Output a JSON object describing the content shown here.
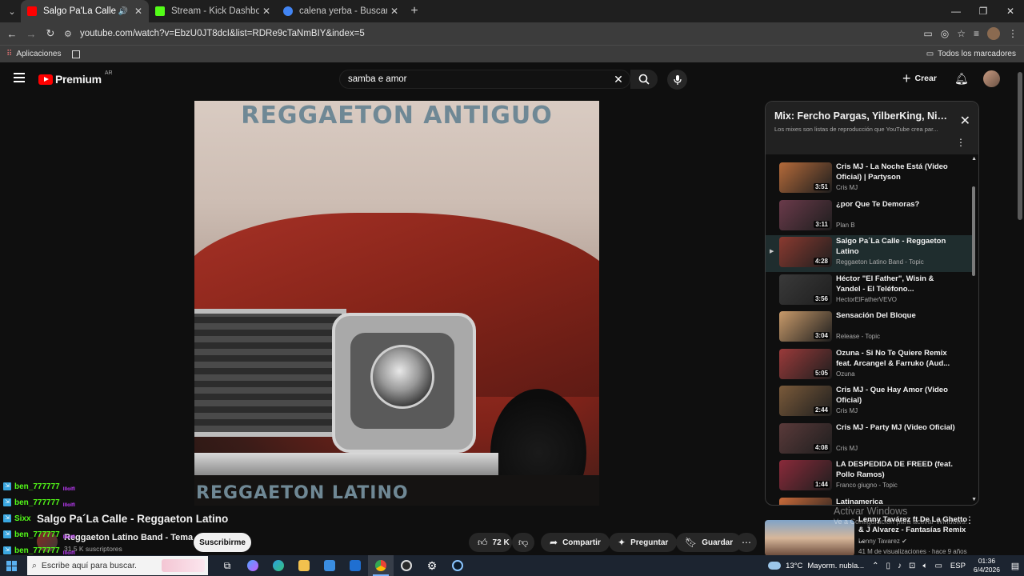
{
  "browser": {
    "tabs": [
      {
        "title": "Salgo Pa'La Calle - Reggae",
        "favicon_color": "#ff0000",
        "active": true,
        "audio": true
      },
      {
        "title": "Stream - Kick Dashboard",
        "favicon_color": "#53fc18",
        "active": false
      },
      {
        "title": "calena yerba - Buscar con Goog",
        "favicon_color": "#4285f4",
        "active": false
      }
    ],
    "url": "youtube.com/watch?v=EbzU0JT8dcI&list=RDRe9cTaNmBIY&index=5",
    "bookmarks": {
      "apps_label": "Aplicaciones",
      "all_label": "Todos los marcadores"
    }
  },
  "youtube": {
    "logo_text": "Premium",
    "region": "AR",
    "search_value": "samba e amor",
    "create_label": "Crear"
  },
  "video": {
    "cover_top_text": "REGGAETON ANTIGUO",
    "cover_bottom_text": "REGGAETON LATINO",
    "title": "Salgo Pa´La Calle - Reggaeton Latino",
    "channel": "Reggaeton Latino Band - Tema",
    "subscribers": "31,5 K suscriptores",
    "subscribe_label": "Suscribirme",
    "likes": "72 K",
    "share_label": "Compartir",
    "ask_label": "Preguntar",
    "save_label": "Guardar"
  },
  "playlist": {
    "title": "Mix: Fercho Pargas, YilberKing, Nico...",
    "subtitle": "Los mixes son listas de reproducción que YouTube crea par...",
    "items": [
      {
        "title": "Cris MJ - La Noche Está (Video Oficial) | Partyson",
        "channel": "Cris MJ",
        "duration": "3:51",
        "thumb": "#b46a3a",
        "active": false
      },
      {
        "title": "¿por Que Te Demoras?",
        "channel": "Plan B",
        "duration": "3:11",
        "thumb": "#6a3a4a",
        "active": false
      },
      {
        "title": "Salgo Pa´La Calle - Reggaeton Latino",
        "channel": "Reggaeton Latino Band - Topic",
        "duration": "4:28",
        "thumb": "#8a3a30",
        "active": true
      },
      {
        "title": "Héctor \"El Father\", Wisin & Yandel - El Teléfono...",
        "channel": "HectorElFatherVEVO",
        "duration": "3:56",
        "thumb": "#3a3a3a",
        "active": false
      },
      {
        "title": "Sensación Del Bloque",
        "channel": "Release - Topic",
        "duration": "3:04",
        "thumb": "#c89a6a",
        "active": false
      },
      {
        "title": "Ozuna - Si No Te Quiere Remix feat. Arcangel & Farruko (Aud...",
        "channel": "Ozuna",
        "duration": "5:05",
        "thumb": "#9a3a3a",
        "active": false
      },
      {
        "title": "Cris MJ - Que Hay Amor (Video Oficial)",
        "channel": "Cris MJ",
        "duration": "2:44",
        "thumb": "#7a5a3a",
        "active": false
      },
      {
        "title": "Cris MJ - Party MJ (Video Oficial)",
        "channel": "Cris MJ",
        "duration": "4:08",
        "thumb": "#5a3a3a",
        "active": false
      },
      {
        "title": "LA DESPEDIDA DE FREED (feat. Pollo Ramos)",
        "channel": "Franco giugno - Topic",
        "duration": "1:44",
        "thumb": "#8a2a3a",
        "active": false
      },
      {
        "title": "Latinamerica",
        "channel": "",
        "duration": "",
        "thumb": "#c86a3a",
        "active": false
      }
    ]
  },
  "recommended": {
    "title": "Lenny Tavárez ft De La Ghetto & J Alvarez - Fantasías Remix ...",
    "channel": "Lenny Tavarez",
    "meta": "41 M de visualizaciones · hace 9 años"
  },
  "windows_watermark": {
    "line1": "Activar Windows",
    "line2": "Ve a Configuración para activar Windows."
  },
  "chat": [
    {
      "user": "ben_777777",
      "emote": "lllolfl"
    },
    {
      "user": "ben_777777",
      "emote": "lllolfl"
    },
    {
      "user": "Sixx",
      "emote": ""
    },
    {
      "user": "ben_777777",
      "emote": "lllolfl"
    },
    {
      "user": "ben_777777",
      "emote": "lllolfl"
    },
    {
      "user": "ben_777777",
      "emote": ""
    }
  ],
  "taskbar": {
    "search_placeholder": "Escribe aquí para buscar.",
    "temperature": "13°C",
    "weather": "Mayorm. nubla...",
    "language": "ESP",
    "time": "01:36",
    "date": "6/4/2026"
  }
}
